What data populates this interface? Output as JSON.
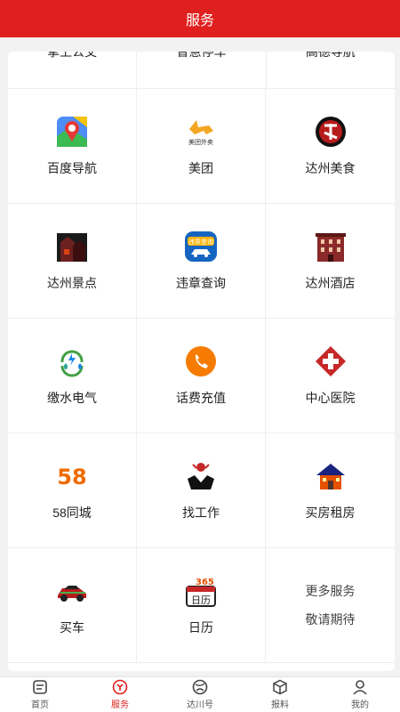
{
  "header": {
    "title": "服务"
  },
  "cut_row": [
    "掌上公交",
    "智慧停车",
    "高德导航"
  ],
  "services": [
    {
      "label": "百度导航",
      "icon": "baidu-map-icon"
    },
    {
      "label": "美团",
      "icon": "meituan-icon"
    },
    {
      "label": "达州美食",
      "icon": "dazhou-food-icon"
    },
    {
      "label": "达州景点",
      "icon": "dazhou-attractions-icon"
    },
    {
      "label": "违章查询",
      "icon": "traffic-violation-icon"
    },
    {
      "label": "达州酒店",
      "icon": "dazhou-hotel-icon"
    },
    {
      "label": "缴水电气",
      "icon": "utilities-payment-icon"
    },
    {
      "label": "话费充值",
      "icon": "phone-recharge-icon"
    },
    {
      "label": "中心医院",
      "icon": "hospital-icon"
    },
    {
      "label": "58同城",
      "icon": "58-city-icon"
    },
    {
      "label": "找工作",
      "icon": "find-job-icon"
    },
    {
      "label": "买房租房",
      "icon": "house-rent-icon"
    },
    {
      "label": "买车",
      "icon": "buy-car-icon"
    },
    {
      "label": "日历",
      "icon": "calendar-icon"
    }
  ],
  "more": {
    "line1": "更多服务",
    "line2": "敬请期待"
  },
  "icon_texts": {
    "meituan": "美团外卖",
    "violation": "违章查询",
    "calendar_num": "365",
    "calendar_word": "日历",
    "num58": "58"
  },
  "tabs": [
    {
      "label": "首页",
      "icon": "home-icon"
    },
    {
      "label": "服务",
      "icon": "service-icon",
      "active": true
    },
    {
      "label": "达川号",
      "icon": "globe-icon"
    },
    {
      "label": "报料",
      "icon": "cube-icon"
    },
    {
      "label": "我的",
      "icon": "user-icon"
    }
  ],
  "colors": {
    "brand": "#e0201f"
  }
}
